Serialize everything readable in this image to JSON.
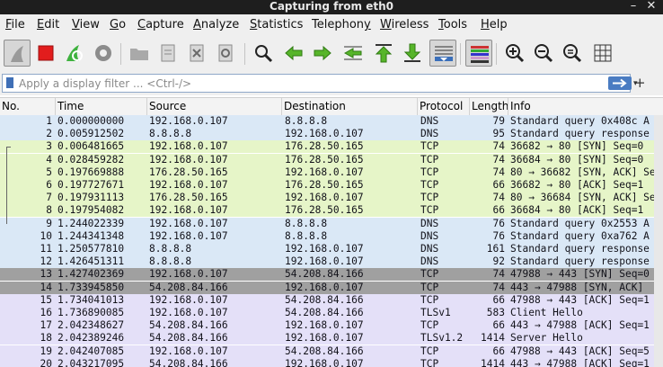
{
  "window": {
    "title": "Capturing from eth0",
    "minimize_label": "–",
    "close_label": "✕"
  },
  "menu": {
    "items": [
      {
        "label": "File",
        "ul": "F",
        "rest": "ile"
      },
      {
        "label": "Edit",
        "ul": "E",
        "rest": "dit"
      },
      {
        "label": "View",
        "ul": "V",
        "rest": "iew"
      },
      {
        "label": "Go",
        "ul": "G",
        "rest": "o"
      },
      {
        "label": "Capture",
        "ul": "C",
        "rest": "apture"
      },
      {
        "label": "Analyze",
        "ul": "A",
        "rest": "nalyze"
      },
      {
        "label": "Statistics",
        "ul": "S",
        "rest": "tatistics"
      },
      {
        "label": "Telephony",
        "ul": "y",
        "pre": "Telephon",
        "rest": ""
      },
      {
        "label": "Wireless",
        "ul": "W",
        "rest": "ireless"
      },
      {
        "label": "Tools",
        "ul": "T",
        "rest": "ools"
      },
      {
        "label": "Help",
        "ul": "H",
        "rest": "elp"
      }
    ]
  },
  "toolbar": {
    "icons": [
      "shark-fin-start-icon",
      "stop-icon",
      "restart-icon",
      "capture-options-icon",
      "open-folder-icon",
      "save-file-icon",
      "close-file-icon",
      "reload-icon",
      "find-packet-icon",
      "go-back-icon",
      "go-forward-icon",
      "go-to-packet-icon",
      "go-first-icon",
      "go-last-icon",
      "auto-scroll-icon",
      "colorize-icon",
      "zoom-in-icon",
      "zoom-out-icon",
      "zoom-normal-icon",
      "resize-columns-icon"
    ],
    "accent": "#3a6fba"
  },
  "filter": {
    "placeholder": "Apply a display filter ... <Ctrl-/>",
    "value": ""
  },
  "table": {
    "headers": {
      "no": "No.",
      "time": "Time",
      "source": "Source",
      "destination": "Destination",
      "protocol": "Protocol",
      "length": "Length",
      "info": "Info"
    },
    "rows": [
      {
        "no": "1",
        "time": "0.000000000",
        "source": "192.168.0.107",
        "destination": "8.8.8.8",
        "protocol": "DNS",
        "length": "79",
        "info": "Standard query 0x408c A",
        "bg": "#dae8f6"
      },
      {
        "no": "2",
        "time": "0.005912502",
        "source": "8.8.8.8",
        "destination": "192.168.0.107",
        "protocol": "DNS",
        "length": "95",
        "info": "Standard query response",
        "bg": "#dae8f6"
      },
      {
        "no": "3",
        "time": "0.006481665",
        "source": "192.168.0.107",
        "destination": "176.28.50.165",
        "protocol": "TCP",
        "length": "74",
        "info": "36682 → 80 [SYN] Seq=0",
        "bg": "#e6f5c8"
      },
      {
        "no": "4",
        "time": "0.028459282",
        "source": "192.168.0.107",
        "destination": "176.28.50.165",
        "protocol": "TCP",
        "length": "74",
        "info": "36684 → 80 [SYN] Seq=0",
        "bg": "#e6f5c8"
      },
      {
        "no": "5",
        "time": "0.197669888",
        "source": "176.28.50.165",
        "destination": "192.168.0.107",
        "protocol": "TCP",
        "length": "74",
        "info": "80 → 36682 [SYN, ACK] Se",
        "bg": "#e6f5c8"
      },
      {
        "no": "6",
        "time": "0.197727671",
        "source": "192.168.0.107",
        "destination": "176.28.50.165",
        "protocol": "TCP",
        "length": "66",
        "info": "36682 → 80 [ACK] Seq=1",
        "bg": "#e6f5c8"
      },
      {
        "no": "7",
        "time": "0.197931113",
        "source": "176.28.50.165",
        "destination": "192.168.0.107",
        "protocol": "TCP",
        "length": "74",
        "info": "80 → 36684 [SYN, ACK] Se",
        "bg": "#e6f5c8"
      },
      {
        "no": "8",
        "time": "0.197954082",
        "source": "192.168.0.107",
        "destination": "176.28.50.165",
        "protocol": "TCP",
        "length": "66",
        "info": "36684 → 80 [ACK] Seq=1",
        "bg": "#e6f5c8"
      },
      {
        "no": "9",
        "time": "1.244022339",
        "source": "192.168.0.107",
        "destination": "8.8.8.8",
        "protocol": "DNS",
        "length": "76",
        "info": "Standard query 0x2553 A",
        "bg": "#dae8f6"
      },
      {
        "no": "10",
        "time": "1.244341348",
        "source": "192.168.0.107",
        "destination": "8.8.8.8",
        "protocol": "DNS",
        "length": "76",
        "info": "Standard query 0xa762 A",
        "bg": "#dae8f6"
      },
      {
        "no": "11",
        "time": "1.250577810",
        "source": "8.8.8.8",
        "destination": "192.168.0.107",
        "protocol": "DNS",
        "length": "161",
        "info": "Standard query response",
        "bg": "#dae8f6"
      },
      {
        "no": "12",
        "time": "1.426451311",
        "source": "8.8.8.8",
        "destination": "192.168.0.107",
        "protocol": "DNS",
        "length": "92",
        "info": "Standard query response",
        "bg": "#dae8f6"
      },
      {
        "no": "13",
        "time": "1.427402369",
        "source": "192.168.0.107",
        "destination": "54.208.84.166",
        "protocol": "TCP",
        "length": "74",
        "info": "47988 → 443 [SYN] Seq=0",
        "bg": "#a0a0a0"
      },
      {
        "no": "14",
        "time": "1.733945850",
        "source": "54.208.84.166",
        "destination": "192.168.0.107",
        "protocol": "TCP",
        "length": "74",
        "info": "443 → 47988 [SYN, ACK]",
        "bg": "#a0a0a0"
      },
      {
        "no": "15",
        "time": "1.734041013",
        "source": "192.168.0.107",
        "destination": "54.208.84.166",
        "protocol": "TCP",
        "length": "66",
        "info": "47988 → 443 [ACK] Seq=1",
        "bg": "#e4e0f8"
      },
      {
        "no": "16",
        "time": "1.736890085",
        "source": "192.168.0.107",
        "destination": "54.208.84.166",
        "protocol": "TLSv1",
        "length": "583",
        "info": "Client Hello",
        "bg": "#e4e0f8"
      },
      {
        "no": "17",
        "time": "2.042348627",
        "source": "54.208.84.166",
        "destination": "192.168.0.107",
        "protocol": "TCP",
        "length": "66",
        "info": "443 → 47988 [ACK] Seq=1",
        "bg": "#e4e0f8"
      },
      {
        "no": "18",
        "time": "2.042389246",
        "source": "54.208.84.166",
        "destination": "192.168.0.107",
        "protocol": "TLSv1.2",
        "length": "1414",
        "info": "Server Hello",
        "bg": "#e4e0f8"
      },
      {
        "no": "19",
        "time": "2.042407085",
        "source": "192.168.0.107",
        "destination": "54.208.84.166",
        "protocol": "TCP",
        "length": "66",
        "info": "47988 → 443 [ACK] Seq=5",
        "bg": "#e4e0f8"
      },
      {
        "no": "20",
        "time": "2.043217095",
        "source": "54.208.84.166",
        "destination": "192.168.0.107",
        "protocol": "TCP",
        "length": "1414",
        "info": "443 → 47988 [ACK] Seq=1",
        "bg": "#e4e0f8"
      }
    ]
  }
}
